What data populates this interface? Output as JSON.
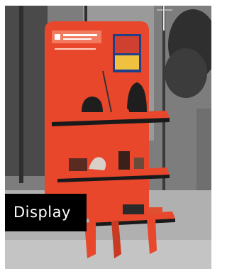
{
  "photo": {
    "subject": "orange-product-display-stand",
    "colors": {
      "stand": "#e8472b",
      "shelf_edge": "#1a1a1a",
      "background": "#8a8a8a"
    }
  },
  "caption": {
    "label": "Display"
  }
}
